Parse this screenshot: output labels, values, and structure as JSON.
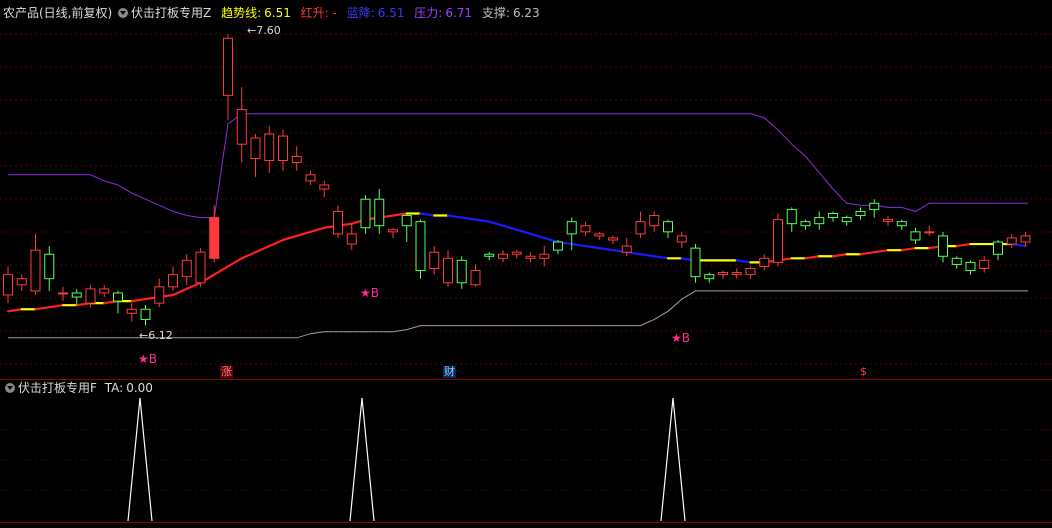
{
  "header": {
    "stock_name": "农产品(日线,前复权)",
    "indicator_name": "伏击打板专用Z",
    "trend_label": "趋势线:",
    "trend_value": "6.51",
    "red_up_label": "红升: -",
    "blue_down_label": "蓝降:",
    "blue_down_value": "6.51",
    "pressure_label": "压力:",
    "pressure_value": "6.71",
    "support_label": "支撑:",
    "support_value": "6.23"
  },
  "annotations": {
    "high_price": "7.60",
    "low_price": "6.12",
    "buy_marker": "★B",
    "event_zhang": "涨",
    "event_cai": "财",
    "event_dollar": "$"
  },
  "sub_header": {
    "indicator_name": "伏击打板专用F",
    "ta_label": "TA:",
    "ta_value": "0.00"
  },
  "colors": {
    "bg": "#000000",
    "up": "#ff3a3a",
    "down": "#55ff55",
    "trend_red": "#ff2020",
    "trend_blue": "#1a1aff",
    "trend_yellow": "#ffff00",
    "pressure": "#8a2be2",
    "support": "#a0a0a0",
    "marker": "#ff2e93",
    "signal": "#ffffff",
    "separator": "#8b0000"
  },
  "chart_data": {
    "type": "candlestick",
    "ylim": [
      6.05,
      7.65
    ],
    "candles": [
      [
        6.32,
        6.42,
        6.28,
        6.46
      ],
      [
        6.37,
        6.4,
        6.34,
        6.42
      ],
      [
        6.34,
        6.54,
        6.32,
        6.62
      ],
      [
        6.52,
        6.4,
        6.34,
        6.56
      ],
      [
        6.33,
        6.33,
        6.29,
        6.36
      ],
      [
        6.33,
        6.31,
        6.27,
        6.35
      ],
      [
        6.28,
        6.35,
        6.26,
        6.37
      ],
      [
        6.33,
        6.35,
        6.31,
        6.37
      ],
      [
        6.33,
        6.29,
        6.23,
        6.34
      ],
      [
        6.23,
        6.25,
        6.19,
        6.28
      ],
      [
        6.25,
        6.2,
        6.17,
        6.27
      ],
      [
        6.28,
        6.36,
        6.26,
        6.4
      ],
      [
        6.36,
        6.42,
        6.34,
        6.46
      ],
      [
        6.41,
        6.49,
        6.37,
        6.52
      ],
      [
        6.38,
        6.53,
        6.36,
        6.55
      ],
      [
        6.5,
        6.7,
        6.48,
        6.76
      ],
      [
        7.3,
        7.58,
        7.18,
        7.6
      ],
      [
        7.06,
        7.23,
        6.97,
        7.34
      ],
      [
        6.99,
        7.09,
        6.9,
        7.11
      ],
      [
        6.98,
        7.11,
        6.92,
        7.15
      ],
      [
        6.98,
        7.1,
        6.93,
        7.13
      ],
      [
        6.97,
        7.0,
        6.93,
        7.05
      ],
      [
        6.88,
        6.91,
        6.86,
        6.93
      ],
      [
        6.84,
        6.86,
        6.8,
        6.88
      ],
      [
        6.62,
        6.73,
        6.6,
        6.76
      ],
      [
        6.57,
        6.62,
        6.54,
        6.67
      ],
      [
        6.79,
        6.65,
        6.62,
        6.81
      ],
      [
        6.79,
        6.66,
        6.62,
        6.84
      ],
      [
        6.63,
        6.64,
        6.6,
        6.65
      ],
      [
        6.71,
        6.66,
        6.58,
        6.72
      ],
      [
        6.68,
        6.44,
        6.4,
        6.69
      ],
      [
        6.45,
        6.53,
        6.42,
        6.56
      ],
      [
        6.38,
        6.5,
        6.36,
        6.54
      ],
      [
        6.49,
        6.38,
        6.35,
        6.51
      ],
      [
        6.37,
        6.44,
        6.36,
        6.47
      ],
      [
        6.52,
        6.51,
        6.49,
        6.53
      ],
      [
        6.5,
        6.52,
        6.48,
        6.54
      ],
      [
        6.52,
        6.53,
        6.5,
        6.54
      ],
      [
        6.5,
        6.51,
        6.48,
        6.53
      ],
      [
        6.5,
        6.52,
        6.46,
        6.56
      ],
      [
        6.58,
        6.54,
        6.52,
        6.59
      ],
      [
        6.68,
        6.62,
        6.54,
        6.7
      ],
      [
        6.63,
        6.66,
        6.61,
        6.68
      ],
      [
        6.61,
        6.62,
        6.59,
        6.63
      ],
      [
        6.59,
        6.6,
        6.57,
        6.61
      ],
      [
        6.53,
        6.56,
        6.51,
        6.6
      ],
      [
        6.62,
        6.68,
        6.6,
        6.73
      ],
      [
        6.66,
        6.71,
        6.63,
        6.73
      ],
      [
        6.68,
        6.63,
        6.6,
        6.69
      ],
      [
        6.58,
        6.61,
        6.55,
        6.63
      ],
      [
        6.55,
        6.41,
        6.38,
        6.57
      ],
      [
        6.42,
        6.4,
        6.38,
        6.43
      ],
      [
        6.42,
        6.43,
        6.4,
        6.44
      ],
      [
        6.42,
        6.43,
        6.4,
        6.45
      ],
      [
        6.42,
        6.45,
        6.4,
        6.46
      ],
      [
        6.46,
        6.5,
        6.44,
        6.52
      ],
      [
        6.48,
        6.69,
        6.46,
        6.72
      ],
      [
        6.74,
        6.67,
        6.63,
        6.75
      ],
      [
        6.68,
        6.66,
        6.64,
        6.69
      ],
      [
        6.7,
        6.67,
        6.64,
        6.73
      ],
      [
        6.72,
        6.7,
        6.68,
        6.73
      ],
      [
        6.7,
        6.68,
        6.66,
        6.71
      ],
      [
        6.73,
        6.71,
        6.69,
        6.75
      ],
      [
        6.77,
        6.74,
        6.7,
        6.79
      ],
      [
        6.68,
        6.69,
        6.66,
        6.71
      ],
      [
        6.68,
        6.66,
        6.64,
        6.69
      ],
      [
        6.63,
        6.59,
        6.57,
        6.65
      ],
      [
        6.63,
        6.63,
        6.61,
        6.66
      ],
      [
        6.61,
        6.51,
        6.48,
        6.63
      ],
      [
        6.5,
        6.47,
        6.45,
        6.51
      ],
      [
        6.48,
        6.44,
        6.42,
        6.49
      ],
      [
        6.45,
        6.49,
        6.43,
        6.51
      ],
      [
        6.58,
        6.52,
        6.49,
        6.59
      ],
      [
        6.57,
        6.6,
        6.55,
        6.62
      ],
      [
        6.58,
        6.61,
        6.56,
        6.63
      ]
    ],
    "trend_line": [
      6.24,
      6.25,
      6.25,
      6.26,
      6.27,
      6.27,
      6.28,
      6.28,
      6.29,
      6.29,
      6.3,
      6.31,
      6.32,
      6.35,
      6.38,
      6.42,
      6.46,
      6.5,
      6.53,
      6.56,
      6.59,
      6.61,
      6.63,
      6.65,
      6.66,
      6.67,
      6.69,
      6.7,
      6.71,
      6.72,
      6.72,
      6.71,
      6.71,
      6.7,
      6.69,
      6.68,
      6.66,
      6.64,
      6.62,
      6.6,
      6.58,
      6.57,
      6.56,
      6.55,
      6.54,
      6.53,
      6.52,
      6.51,
      6.5,
      6.5,
      6.49,
      6.49,
      6.49,
      6.49,
      6.48,
      6.48,
      6.49,
      6.5,
      6.5,
      6.51,
      6.51,
      6.52,
      6.52,
      6.53,
      6.54,
      6.54,
      6.55,
      6.55,
      6.56,
      6.56,
      6.57,
      6.57,
      6.57,
      6.57,
      6.56
    ],
    "pressure_line": [
      6.91,
      6.91,
      6.91,
      6.91,
      6.91,
      6.91,
      6.91,
      6.88,
      6.86,
      6.82,
      6.79,
      6.76,
      6.73,
      6.71,
      6.7,
      6.7,
      7.16,
      7.21,
      7.21,
      7.21,
      7.21,
      7.21,
      7.21,
      7.21,
      7.21,
      7.21,
      7.21,
      7.21,
      7.21,
      7.21,
      7.21,
      7.21,
      7.21,
      7.21,
      7.21,
      7.21,
      7.21,
      7.21,
      7.21,
      7.21,
      7.21,
      7.21,
      7.21,
      7.21,
      7.21,
      7.21,
      7.21,
      7.21,
      7.21,
      7.21,
      7.21,
      7.21,
      7.21,
      7.21,
      7.21,
      7.19,
      7.13,
      7.06,
      7.0,
      6.92,
      6.84,
      6.77,
      6.76,
      6.76,
      6.75,
      6.75,
      6.73,
      6.77,
      6.77,
      6.77,
      6.77,
      6.77,
      6.77,
      6.77,
      6.77
    ],
    "support_line": [
      6.11,
      6.11,
      6.11,
      6.11,
      6.11,
      6.11,
      6.11,
      6.11,
      6.11,
      6.11,
      6.11,
      6.11,
      6.11,
      6.11,
      6.11,
      6.11,
      6.11,
      6.11,
      6.11,
      6.11,
      6.11,
      6.11,
      6.13,
      6.14,
      6.14,
      6.14,
      6.14,
      6.14,
      6.14,
      6.15,
      6.17,
      6.17,
      6.17,
      6.17,
      6.17,
      6.17,
      6.17,
      6.17,
      6.17,
      6.17,
      6.17,
      6.17,
      6.17,
      6.17,
      6.17,
      6.17,
      6.17,
      6.2,
      6.24,
      6.3,
      6.34,
      6.34,
      6.34,
      6.34,
      6.34,
      6.34,
      6.34,
      6.34,
      6.34,
      6.34,
      6.34,
      6.34,
      6.34,
      6.34,
      6.34,
      6.34,
      6.34,
      6.34,
      6.34,
      6.34,
      6.34,
      6.34,
      6.34,
      6.34,
      6.34
    ],
    "buy_signals": [
      9,
      23,
      43
    ],
    "ta_ylim": [
      0,
      1
    ]
  }
}
